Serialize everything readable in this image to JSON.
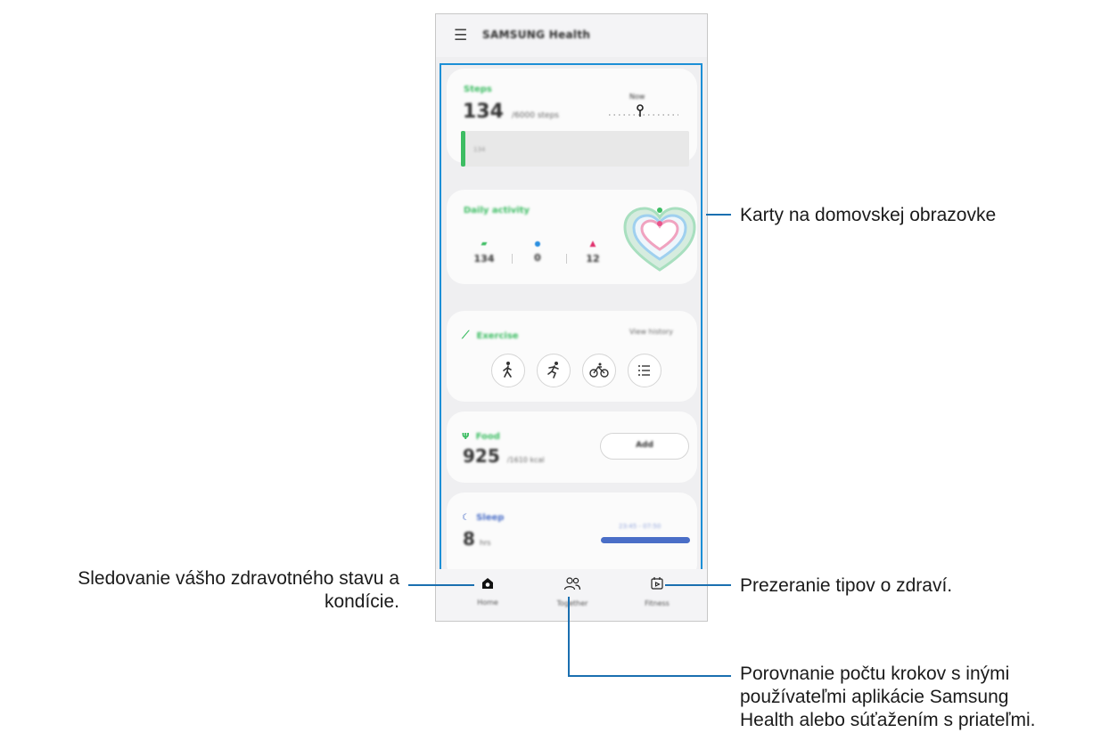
{
  "app": {
    "title": "SAMSUNG Health",
    "menu_icon": "hamburger-menu-icon"
  },
  "cards": {
    "steps": {
      "title": "Steps",
      "value": "134",
      "unit": "/6000 steps",
      "marker_label": "Now",
      "bar_hint": "134",
      "progress": 0.02,
      "accent": "#3dbd63"
    },
    "daily_activity": {
      "title": "Daily activity",
      "steps": "134",
      "active_minutes": "0",
      "calories": "12",
      "accent": "#3dbd63"
    },
    "exercise": {
      "title": "Exercise",
      "link": "View history",
      "icons": [
        "walking-icon",
        "running-icon",
        "cycling-icon",
        "list-icon"
      ],
      "accent": "#3dbd63"
    },
    "food": {
      "title": "Food",
      "value": "925",
      "unit": "/1610 kcal",
      "button_label": "Add",
      "accent": "#3dbd63"
    },
    "sleep": {
      "title": "Sleep",
      "value": "8",
      "unit": "hrs",
      "time_range": "23:45 - 07:50",
      "accent": "#4a6ec7"
    }
  },
  "bottom_nav": [
    {
      "label": "Home",
      "icon": "home-icon"
    },
    {
      "label": "Together",
      "icon": "people-icon"
    },
    {
      "label": "Fitness",
      "icon": "video-calendar-icon"
    }
  ],
  "callouts": {
    "cards": "Karty na domovskej obrazovke",
    "home_line1": "Sledovanie vášho zdravotného stavu a",
    "home_line2": "kondície.",
    "fitness": "Prezeranie tipov o zdraví.",
    "together_line1": "Porovnanie počtu krokov s inými",
    "together_line2": "používateľmi aplikácie Samsung",
    "together_line3": "Health alebo súťažením s priateľmi."
  },
  "colors": {
    "highlight": "#1c8fd6",
    "callout_line": "#1a6fb0"
  }
}
